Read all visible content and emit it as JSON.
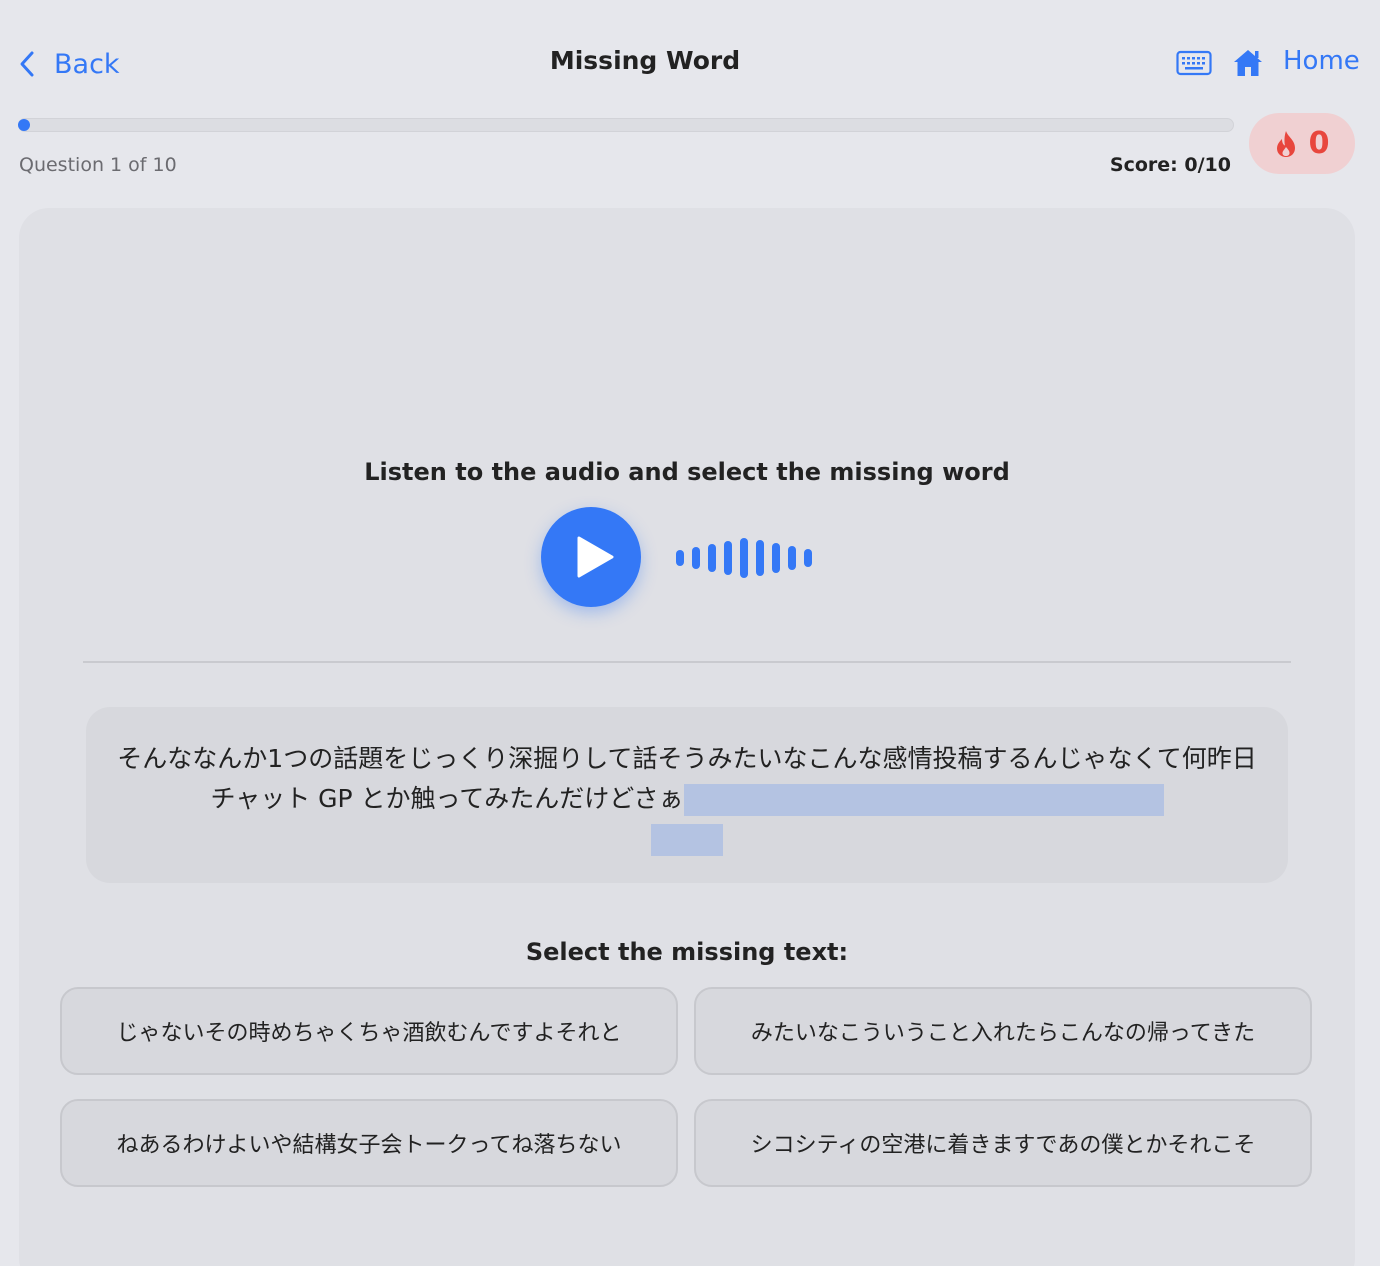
{
  "header": {
    "back_label": "Back",
    "title": "Missing Word",
    "home_label": "Home"
  },
  "progress": {
    "question_label": "Question 1 of 10",
    "score_label": "Score: 0/10",
    "fraction": 0.0,
    "streak_count": "0"
  },
  "quiz": {
    "instruction": "Listen to the audio and select the missing word",
    "sentence": "そんななんか1つの話題をじっくり深掘りして話そうみたいなこんな感情投稿するんじゃなくて何昨日チャット GP とか触ってみたんだけどさぁ",
    "select_label": "Select the missing text:",
    "options": [
      "じゃないその時めちゃくちゃ酒飲むんですよそれと",
      "みたいなこういうこと入れたらこんなの帰ってきた",
      "ねあるわけよいや結構女子会トークってね落ちない",
      "シコシティの空港に着きますであの僕とかそれこそ"
    ]
  },
  "colors": {
    "accent": "#3478f6",
    "streak_bg": "#f0d0d2",
    "streak_text": "#e8463d",
    "blank_highlight": "#b4c3e2"
  },
  "icons": {
    "back": "chevron-left-icon",
    "keyboard": "keyboard-icon",
    "home": "home-icon",
    "streak": "flame-icon",
    "play": "play-icon",
    "audio": "waveform-icon"
  }
}
